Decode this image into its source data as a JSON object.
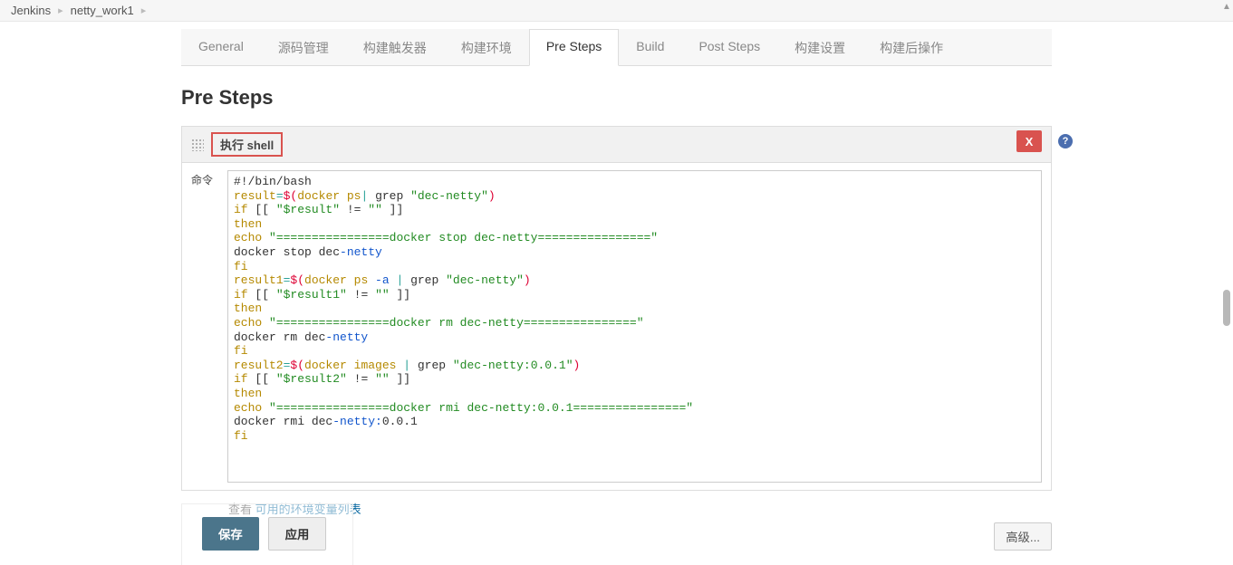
{
  "breadcrumb": {
    "root": "Jenkins",
    "project": "netty_work1"
  },
  "tabs": [
    {
      "id": "general",
      "label": "General"
    },
    {
      "id": "scm",
      "label": "源码管理"
    },
    {
      "id": "triggers",
      "label": "构建触发器"
    },
    {
      "id": "env",
      "label": "构建环境"
    },
    {
      "id": "presteps",
      "label": "Pre Steps"
    },
    {
      "id": "build",
      "label": "Build"
    },
    {
      "id": "poststeps",
      "label": "Post Steps"
    },
    {
      "id": "settings",
      "label": "构建设置"
    },
    {
      "id": "postactions",
      "label": "构建后操作"
    }
  ],
  "section": {
    "title": "Pre Steps"
  },
  "step": {
    "type_label": "执行 shell",
    "delete_label": "X",
    "field_label": "命令",
    "script_lines": [
      [
        {
          "t": "#!/bin/bash",
          "c": ""
        }
      ],
      [
        {
          "t": "result",
          "c": "c-orange"
        },
        {
          "t": "=",
          "c": "c-cyan"
        },
        {
          "t": "$(",
          "c": "c-red"
        },
        {
          "t": "docker ps",
          "c": "c-orange"
        },
        {
          "t": "|",
          "c": "c-cyan"
        },
        {
          "t": " grep ",
          "c": ""
        },
        {
          "t": "\"dec-netty\"",
          "c": "c-green"
        },
        {
          "t": ")",
          "c": "c-red"
        }
      ],
      [
        {
          "t": "if",
          "c": "c-orange"
        },
        {
          "t": " [[ ",
          "c": ""
        },
        {
          "t": "\"$result\"",
          "c": "c-green"
        },
        {
          "t": " != ",
          "c": ""
        },
        {
          "t": "\"\"",
          "c": "c-green"
        },
        {
          "t": " ]]",
          "c": ""
        }
      ],
      [
        {
          "t": "then",
          "c": "c-orange"
        }
      ],
      [
        {
          "t": "echo",
          "c": "c-orange"
        },
        {
          "t": " ",
          "c": ""
        },
        {
          "t": "\"================docker stop dec-netty================\"",
          "c": "c-green"
        }
      ],
      [
        {
          "t": "docker stop dec",
          "c": ""
        },
        {
          "t": "-netty",
          "c": "c-navy"
        }
      ],
      [
        {
          "t": "fi",
          "c": "c-orange"
        }
      ],
      [
        {
          "t": "result1",
          "c": "c-orange"
        },
        {
          "t": "=",
          "c": "c-cyan"
        },
        {
          "t": "$(",
          "c": "c-red"
        },
        {
          "t": "docker ps ",
          "c": "c-orange"
        },
        {
          "t": "-a",
          "c": "c-navy"
        },
        {
          "t": " ",
          "c": ""
        },
        {
          "t": "|",
          "c": "c-cyan"
        },
        {
          "t": " grep ",
          "c": ""
        },
        {
          "t": "\"dec-netty\"",
          "c": "c-green"
        },
        {
          "t": ")",
          "c": "c-red"
        }
      ],
      [
        {
          "t": "if",
          "c": "c-orange"
        },
        {
          "t": " [[ ",
          "c": ""
        },
        {
          "t": "\"$result1\"",
          "c": "c-green"
        },
        {
          "t": " != ",
          "c": ""
        },
        {
          "t": "\"\"",
          "c": "c-green"
        },
        {
          "t": " ]]",
          "c": ""
        }
      ],
      [
        {
          "t": "then",
          "c": "c-orange"
        }
      ],
      [
        {
          "t": "echo",
          "c": "c-orange"
        },
        {
          "t": " ",
          "c": ""
        },
        {
          "t": "\"================docker rm dec-netty================\"",
          "c": "c-green"
        }
      ],
      [
        {
          "t": "docker rm dec",
          "c": ""
        },
        {
          "t": "-netty",
          "c": "c-navy"
        }
      ],
      [
        {
          "t": "fi",
          "c": "c-orange"
        }
      ],
      [
        {
          "t": "result2",
          "c": "c-orange"
        },
        {
          "t": "=",
          "c": "c-cyan"
        },
        {
          "t": "$(",
          "c": "c-red"
        },
        {
          "t": "docker images ",
          "c": "c-orange"
        },
        {
          "t": "|",
          "c": "c-cyan"
        },
        {
          "t": " grep ",
          "c": ""
        },
        {
          "t": "\"dec-netty:0.0.1\"",
          "c": "c-green"
        },
        {
          "t": ")",
          "c": "c-red"
        }
      ],
      [
        {
          "t": "if",
          "c": "c-orange"
        },
        {
          "t": " [[ ",
          "c": ""
        },
        {
          "t": "\"$result2\"",
          "c": "c-green"
        },
        {
          "t": " != ",
          "c": ""
        },
        {
          "t": "\"\"",
          "c": "c-green"
        },
        {
          "t": " ]]",
          "c": ""
        }
      ],
      [
        {
          "t": "then",
          "c": "c-orange"
        }
      ],
      [
        {
          "t": "echo",
          "c": "c-orange"
        },
        {
          "t": " ",
          "c": ""
        },
        {
          "t": "\"================docker rmi dec-netty:0.0.1================\"",
          "c": "c-green"
        }
      ],
      [
        {
          "t": "docker rmi dec",
          "c": ""
        },
        {
          "t": "-netty:",
          "c": "c-navy"
        },
        {
          "t": "0.0.1",
          "c": ""
        }
      ],
      [
        {
          "t": "fi",
          "c": "c-orange"
        }
      ]
    ]
  },
  "see_also": {
    "prefix": "查看 ",
    "link": "可用的环境变量列表"
  },
  "advanced": {
    "label": "高级..."
  },
  "buttons": {
    "save": "保存",
    "apply": "应用"
  },
  "help_icon": "?"
}
